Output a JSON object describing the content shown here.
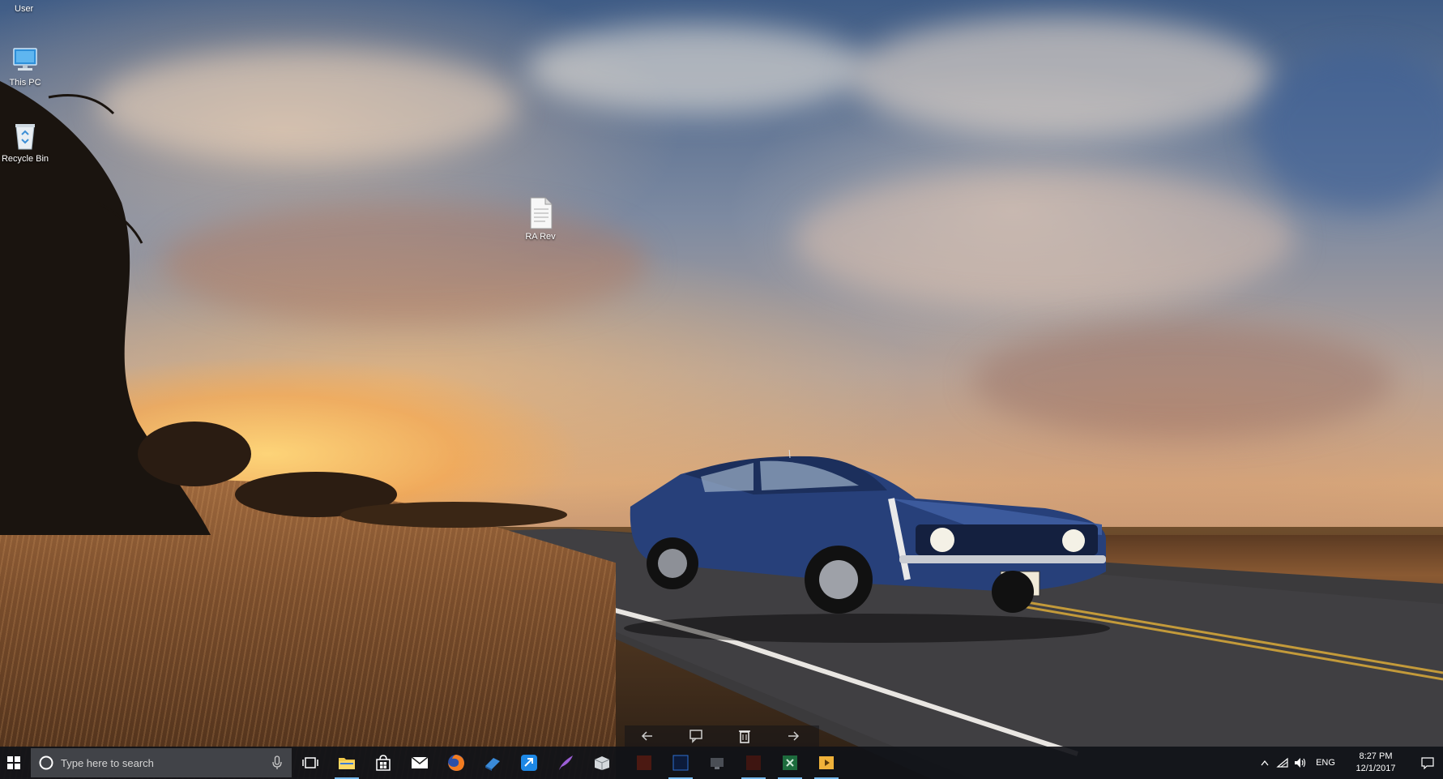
{
  "desktop": {
    "user_folder": "User",
    "icons": [
      {
        "label": "This PC",
        "icon": "computer-icon"
      },
      {
        "label": "Recycle Bin",
        "icon": "recycle-bin-icon"
      },
      {
        "label": "RA Rev",
        "icon": "document-icon"
      }
    ],
    "wallpaper": "blue classic muscle car on road at sunset"
  },
  "taskbar": {
    "search_placeholder": "Type here to search",
    "pinned_apps": [
      {
        "name": "task-view",
        "icon": "task-view-icon"
      },
      {
        "name": "file-explorer",
        "icon": "folder-icon",
        "running": true
      },
      {
        "name": "store",
        "icon": "store-icon"
      },
      {
        "name": "mail",
        "icon": "mail-icon"
      },
      {
        "name": "firefox",
        "icon": "firefox-icon"
      },
      {
        "name": "app-blue-books",
        "icon": "books-icon"
      },
      {
        "name": "app-blue-arrow",
        "icon": "arrow-app-icon"
      },
      {
        "name": "app-quill",
        "icon": "quill-icon"
      },
      {
        "name": "app-box",
        "icon": "box-icon"
      },
      {
        "name": "app-red",
        "icon": "red-app-icon"
      },
      {
        "name": "photoshop",
        "icon": "photoshop-icon",
        "running": true
      },
      {
        "name": "app-monitor",
        "icon": "monitor-app-icon"
      },
      {
        "name": "app-red-2",
        "icon": "red-app-icon",
        "running": true
      },
      {
        "name": "excel",
        "icon": "excel-icon",
        "running": true
      },
      {
        "name": "media",
        "icon": "media-icon",
        "running": true
      }
    ],
    "tray": {
      "language": "ENG",
      "time": "8:27 PM",
      "date": "12/1/2017"
    }
  },
  "colors": {
    "taskbar_bg": "#101218",
    "accent": "#76b9ed",
    "search_bg": "#46484e"
  }
}
